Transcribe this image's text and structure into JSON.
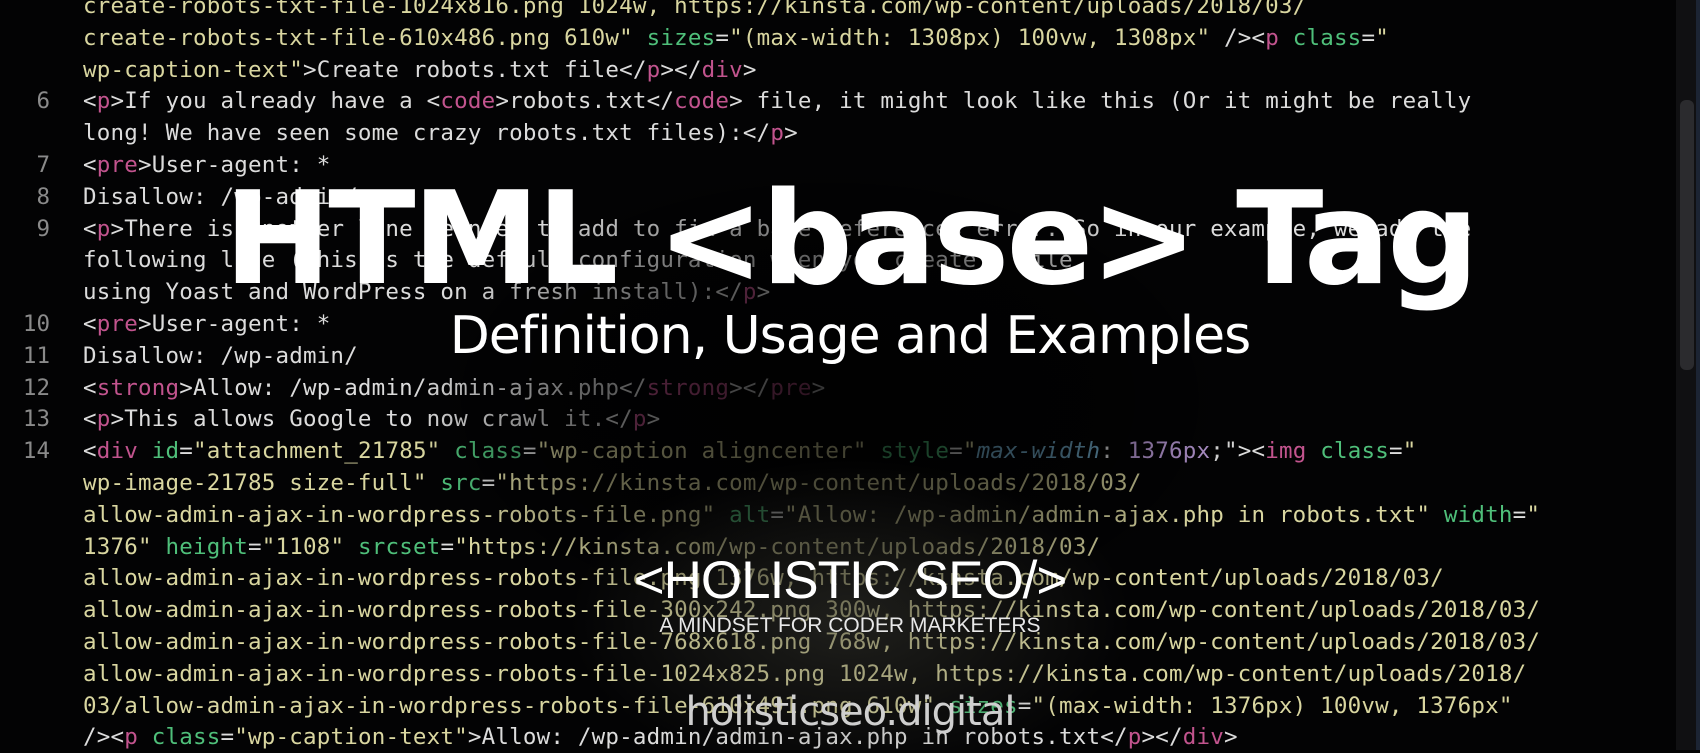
{
  "editor": {
    "lines": [
      {
        "num": "",
        "segments": [
          {
            "c": "s",
            "t": "create-robots-txt-file-1024x816.png 1024w, https://kinsta.com/wp-content/uploads/2018/03/"
          }
        ]
      },
      {
        "num": "",
        "segments": [
          {
            "c": "s",
            "t": "create-robots-txt-file-610x486.png 610w\" "
          },
          {
            "c": "a",
            "t": "sizes"
          },
          {
            "c": "p",
            "t": "="
          },
          {
            "c": "s",
            "t": "\"(max-width: 1308px) 100vw, 1308px\" "
          },
          {
            "c": "p",
            "t": "/><"
          },
          {
            "c": "t",
            "t": "p"
          },
          {
            "c": "a",
            "t": " class"
          },
          {
            "c": "p",
            "t": "="
          },
          {
            "c": "s",
            "t": "\""
          }
        ]
      },
      {
        "num": "",
        "segments": [
          {
            "c": "s",
            "t": "wp-caption-text\""
          },
          {
            "c": "p",
            "t": ">Create robots.txt file</"
          },
          {
            "c": "t",
            "t": "p"
          },
          {
            "c": "p",
            "t": "></"
          },
          {
            "c": "t",
            "t": "div"
          },
          {
            "c": "p",
            "t": ">"
          }
        ]
      },
      {
        "num": "6",
        "segments": [
          {
            "c": "p",
            "t": "<"
          },
          {
            "c": "t",
            "t": "p"
          },
          {
            "c": "p",
            "t": ">If you already have a <"
          },
          {
            "c": "t",
            "t": "code"
          },
          {
            "c": "p",
            "t": ">robots.txt</"
          },
          {
            "c": "t",
            "t": "code"
          },
          {
            "c": "p",
            "t": "> file, it might look like this (Or it might be really"
          }
        ]
      },
      {
        "num": "",
        "segments": [
          {
            "c": "p",
            "t": "long! We have seen some crazy robots.txt files):</"
          },
          {
            "c": "t",
            "t": "p"
          },
          {
            "c": "p",
            "t": ">"
          }
        ]
      },
      {
        "num": "7",
        "segments": [
          {
            "c": "p",
            "t": "<"
          },
          {
            "c": "t",
            "t": "pre"
          },
          {
            "c": "p",
            "t": ">User-agent: *"
          }
        ]
      },
      {
        "num": "8",
        "segments": [
          {
            "c": "p",
            "t": "Disallow: /wp-admin/"
          }
        ]
      },
      {
        "num": "9",
        "segments": [
          {
            "c": "p",
            "t": "<"
          },
          {
            "c": "t",
            "t": "p"
          },
          {
            "c": "p",
            "t": ">There is another line we need to add to fix a base references error. So in our example, we add the"
          }
        ]
      },
      {
        "num": "",
        "segments": [
          {
            "c": "p",
            "t": "following line (this is the default configuration when you create a file"
          }
        ]
      },
      {
        "num": "",
        "segments": [
          {
            "c": "p",
            "t": "using Yoast and WordPress on a fresh install):</"
          },
          {
            "c": "t",
            "t": "p"
          },
          {
            "c": "p",
            "t": ">"
          }
        ]
      },
      {
        "num": "10",
        "segments": [
          {
            "c": "p",
            "t": "<"
          },
          {
            "c": "t",
            "t": "pre"
          },
          {
            "c": "p",
            "t": ">User-agent: *"
          }
        ]
      },
      {
        "num": "11",
        "segments": [
          {
            "c": "p",
            "t": "Disallow: /wp-admin/"
          }
        ]
      },
      {
        "num": "12",
        "segments": [
          {
            "c": "p",
            "t": "<"
          },
          {
            "c": "t",
            "t": "strong"
          },
          {
            "c": "p",
            "t": ">Allow: /wp-admin/admin-ajax.php</"
          },
          {
            "c": "t",
            "t": "strong"
          },
          {
            "c": "p",
            "t": "></"
          },
          {
            "c": "t",
            "t": "pre"
          },
          {
            "c": "p",
            "t": ">"
          }
        ]
      },
      {
        "num": "13",
        "segments": [
          {
            "c": "p",
            "t": "<"
          },
          {
            "c": "t",
            "t": "p"
          },
          {
            "c": "p",
            "t": ">This allows Google to now crawl it.</"
          },
          {
            "c": "t",
            "t": "p"
          },
          {
            "c": "p",
            "t": ">"
          }
        ]
      },
      {
        "num": "14",
        "segments": [
          {
            "c": "p",
            "t": "<"
          },
          {
            "c": "t",
            "t": "div"
          },
          {
            "c": "a",
            "t": " id"
          },
          {
            "c": "p",
            "t": "="
          },
          {
            "c": "s",
            "t": "\"attachment_21785\" "
          },
          {
            "c": "a",
            "t": "class"
          },
          {
            "c": "p",
            "t": "="
          },
          {
            "c": "s",
            "t": "\"wp-caption aligncenter\" "
          },
          {
            "c": "a",
            "t": "style"
          },
          {
            "c": "p",
            "t": "="
          },
          {
            "c": "s",
            "t": "\""
          },
          {
            "c": "i",
            "t": "max-width"
          },
          {
            "c": "p",
            "t": ": "
          },
          {
            "c": "n",
            "t": "1376px"
          },
          {
            "c": "p",
            "t": ";\"><"
          },
          {
            "c": "t",
            "t": "img"
          },
          {
            "c": "a",
            "t": " class"
          },
          {
            "c": "p",
            "t": "="
          },
          {
            "c": "s",
            "t": "\""
          }
        ]
      },
      {
        "num": "",
        "segments": [
          {
            "c": "s",
            "t": "wp-image-21785 size-full\" "
          },
          {
            "c": "a",
            "t": "src"
          },
          {
            "c": "p",
            "t": "="
          },
          {
            "c": "s",
            "t": "\"https://kinsta.com/wp-content/uploads/2018/03/"
          }
        ]
      },
      {
        "num": "",
        "segments": [
          {
            "c": "s",
            "t": "allow-admin-ajax-in-wordpress-robots-file.png\" "
          },
          {
            "c": "a",
            "t": "alt"
          },
          {
            "c": "p",
            "t": "="
          },
          {
            "c": "s",
            "t": "\"Allow: /wp-admin/admin-ajax.php in robots.txt\" "
          },
          {
            "c": "a",
            "t": "width"
          },
          {
            "c": "p",
            "t": "="
          },
          {
            "c": "s",
            "t": "\""
          }
        ]
      },
      {
        "num": "",
        "segments": [
          {
            "c": "s",
            "t": "1376\" "
          },
          {
            "c": "a",
            "t": "height"
          },
          {
            "c": "p",
            "t": "="
          },
          {
            "c": "s",
            "t": "\"1108\" "
          },
          {
            "c": "a",
            "t": "srcset"
          },
          {
            "c": "p",
            "t": "="
          },
          {
            "c": "s",
            "t": "\"https://kinsta.com/wp-content/uploads/2018/03/"
          }
        ]
      },
      {
        "num": "",
        "segments": [
          {
            "c": "s",
            "t": "allow-admin-ajax-in-wordpress-robots-file.png 1376w, https://kinsta.com/wp-content/uploads/2018/03/"
          }
        ]
      },
      {
        "num": "",
        "segments": [
          {
            "c": "s",
            "t": "allow-admin-ajax-in-wordpress-robots-file-300x242.png 300w, https://kinsta.com/wp-content/uploads/2018/03/"
          }
        ]
      },
      {
        "num": "",
        "segments": [
          {
            "c": "s",
            "t": "allow-admin-ajax-in-wordpress-robots-file-768x618.png 768w, https://kinsta.com/wp-content/uploads/2018/03/"
          }
        ]
      },
      {
        "num": "",
        "segments": [
          {
            "c": "s",
            "t": "allow-admin-ajax-in-wordpress-robots-file-1024x825.png 1024w, https://kinsta.com/wp-content/uploads/2018/"
          }
        ]
      },
      {
        "num": "",
        "segments": [
          {
            "c": "s",
            "t": "03/allow-admin-ajax-in-wordpress-robots-file-610x491.png 610w\" "
          },
          {
            "c": "a",
            "t": "sizes"
          },
          {
            "c": "p",
            "t": "="
          },
          {
            "c": "s",
            "t": "\"(max-width: 1376px) 100vw, 1376px\""
          }
        ]
      },
      {
        "num": "",
        "segments": [
          {
            "c": "p",
            "t": "/><"
          },
          {
            "c": "t",
            "t": "p"
          },
          {
            "c": "a",
            "t": " class"
          },
          {
            "c": "p",
            "t": "="
          },
          {
            "c": "s",
            "t": "\"wp-caption-text\""
          },
          {
            "c": "p",
            "t": ">Allow: /wp-admin/admin-ajax.php in robots.txt</"
          },
          {
            "c": "t",
            "t": "p"
          },
          {
            "c": "p",
            "t": "></"
          },
          {
            "c": "t",
            "t": "div"
          },
          {
            "c": "p",
            "t": ">"
          }
        ]
      }
    ]
  },
  "overlay": {
    "title": "HTML <base> Tag",
    "subtitle": "Definition, Usage and Examples",
    "brand": "<HOLISTIC SEO/>",
    "tagline": "A MINDSET FOR CODER  MARKETERS",
    "domain": "holisticseo.digital"
  },
  "icons": {
    "scrollbar": "vertical-scrollbar"
  }
}
